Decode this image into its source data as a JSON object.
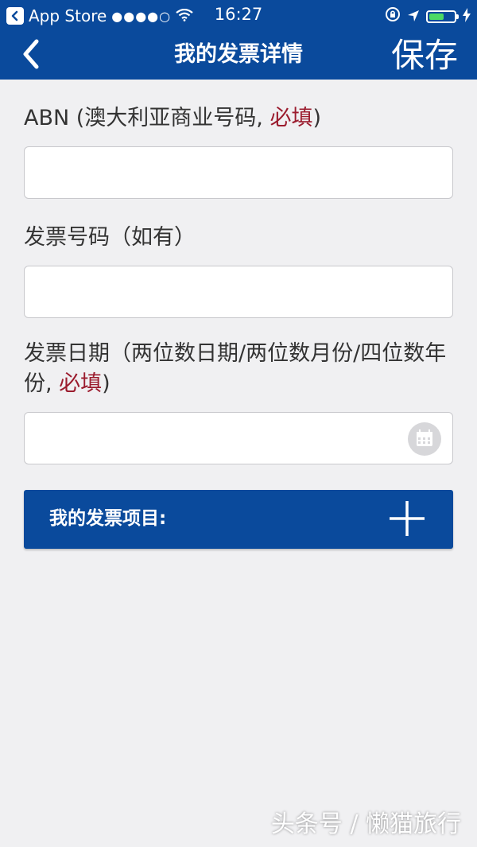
{
  "status_bar": {
    "carrier": "App Store",
    "signal": "●●●●○",
    "time": "16:27"
  },
  "nav": {
    "title": "我的发票详情",
    "save_label": "保存"
  },
  "form": {
    "abn": {
      "label_prefix": "ABN (澳大利亚商业号码, ",
      "required": "必填",
      "label_suffix": ")",
      "value": ""
    },
    "invoice_number": {
      "label": "发票号码（如有）",
      "value": ""
    },
    "invoice_date": {
      "label_prefix": "发票日期（两位数日期/两位数月份/四位数年份, ",
      "required": "必填",
      "label_suffix": ")",
      "value": ""
    },
    "items_bar_label": "我的发票项目:"
  },
  "watermark": "头条号 / 懒猫旅行",
  "icons": {
    "back": "chevron-left-icon",
    "calendar": "calendar-icon",
    "add": "plus-icon",
    "app_store": "app-store-icon",
    "wifi": "wifi-icon",
    "location": "location-icon",
    "lock": "rotation-lock-icon",
    "battery": "battery-icon",
    "charging": "charging-icon"
  },
  "colors": {
    "primary": "#0a4a9c",
    "required": "#9b1c2e",
    "background": "#f0f0f2",
    "battery_fill": "#4cd964"
  }
}
